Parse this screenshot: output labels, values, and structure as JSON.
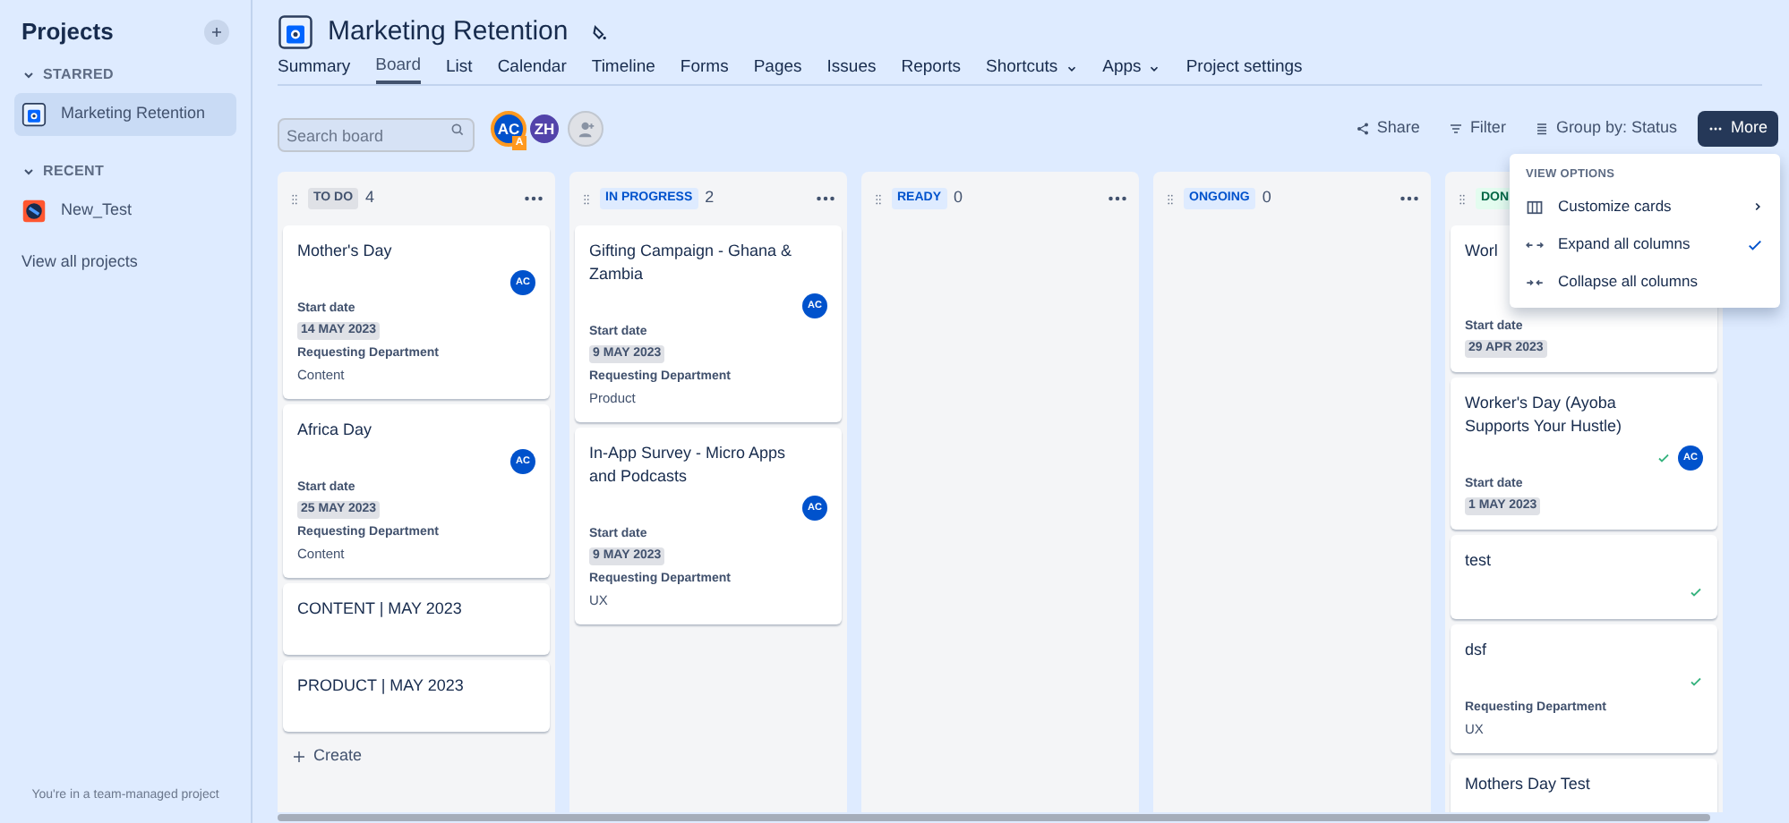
{
  "sidebar": {
    "title": "Projects",
    "sections": [
      {
        "heading": "STARRED",
        "expanded": true,
        "items": [
          {
            "label": "Marketing Retention",
            "selected": true,
            "kind": "board"
          }
        ]
      },
      {
        "heading": "RECENT",
        "expanded": true,
        "items": [
          {
            "label": "New_Test",
            "selected": false,
            "kind": "test"
          }
        ]
      }
    ],
    "view_all": "View all projects",
    "footer": "You're in a team-managed project"
  },
  "project": {
    "title": "Marketing Retention"
  },
  "tabs": [
    {
      "label": "Summary",
      "selected": false,
      "dropdown": false
    },
    {
      "label": "Board",
      "selected": true,
      "dropdown": false
    },
    {
      "label": "List",
      "selected": false,
      "dropdown": false
    },
    {
      "label": "Calendar",
      "selected": false,
      "dropdown": false
    },
    {
      "label": "Timeline",
      "selected": false,
      "dropdown": false
    },
    {
      "label": "Forms",
      "selected": false,
      "dropdown": false
    },
    {
      "label": "Pages",
      "selected": false,
      "dropdown": false
    },
    {
      "label": "Issues",
      "selected": false,
      "dropdown": false
    },
    {
      "label": "Reports",
      "selected": false,
      "dropdown": false
    },
    {
      "label": "Shortcuts",
      "selected": false,
      "dropdown": true
    },
    {
      "label": "Apps",
      "selected": false,
      "dropdown": true
    },
    {
      "label": "Project settings",
      "selected": false,
      "dropdown": false
    }
  ],
  "toolbar": {
    "search": {
      "placeholder": "Search board"
    },
    "avatars": [
      {
        "initials": "AC",
        "color": "#0052cc",
        "badge": "A"
      },
      {
        "initials": "ZH",
        "color": "#5243aa"
      }
    ],
    "actions": [
      {
        "label": "Share",
        "kind": "share"
      },
      {
        "label": "Filter",
        "kind": "filter"
      },
      {
        "label": "Group by: Status",
        "kind": "group"
      },
      {
        "label": "More",
        "kind": "more"
      }
    ]
  },
  "columns": [
    {
      "status": "TO DO",
      "kind": "todo",
      "count": "4",
      "cards": [
        {
          "title": "Mother's Day",
          "avatar": "AC",
          "done": false,
          "fields": [
            {
              "label": "Start date",
              "value": "14 MAY 2023",
              "kind": "date"
            },
            {
              "label": "Requesting Department",
              "value": "Content",
              "kind": "text"
            }
          ]
        },
        {
          "title": "Africa Day",
          "avatar": "AC",
          "done": false,
          "fields": [
            {
              "label": "Start date",
              "value": "25 MAY 2023",
              "kind": "date"
            },
            {
              "label": "Requesting Department",
              "value": "Content",
              "kind": "text"
            }
          ]
        },
        {
          "title": "CONTENT | MAY 2023",
          "done": false
        },
        {
          "title": "PRODUCT | MAY 2023",
          "done": false
        }
      ],
      "create": "Create"
    },
    {
      "status": "IN PROGRESS",
      "kind": "active",
      "count": "2",
      "cards": [
        {
          "title": "Gifting Campaign - Ghana & Zambia",
          "avatar": "AC",
          "done": false,
          "fields": [
            {
              "label": "Start date",
              "value": "9 MAY 2023",
              "kind": "date"
            },
            {
              "label": "Requesting Department",
              "value": "Product",
              "kind": "text"
            }
          ]
        },
        {
          "title": "In-App Survey - Micro Apps and Podcasts",
          "avatar": "AC",
          "done": false,
          "fields": [
            {
              "label": "Start date",
              "value": "9 MAY 2023",
              "kind": "date"
            },
            {
              "label": "Requesting Department",
              "value": "UX",
              "kind": "text"
            }
          ]
        }
      ]
    },
    {
      "status": "READY",
      "kind": "active",
      "count": "0"
    },
    {
      "status": "ONGOING",
      "kind": "active",
      "count": "0"
    },
    {
      "status": "DON",
      "kind": "done",
      "cards": [
        {
          "title": "Worl",
          "done": false,
          "fields": [
            {
              "label": "Start date",
              "value": "29 APR 2023",
              "kind": "date"
            }
          ]
        },
        {
          "title": "Worker's Day (Ayoba Supports Your Hustle)",
          "avatar": "AC",
          "done": true,
          "fields": [
            {
              "label": "Start date",
              "value": "1 MAY 2023",
              "kind": "date"
            }
          ]
        },
        {
          "title": "test",
          "done": true
        },
        {
          "title": "dsf",
          "done": true,
          "fields": [
            {
              "label": "Requesting Department",
              "value": "UX",
              "kind": "text"
            }
          ]
        },
        {
          "title": "Mothers Day Test",
          "done": false
        }
      ]
    }
  ],
  "menu": {
    "heading": "VIEW OPTIONS",
    "items": [
      {
        "label": "Customize cards",
        "kind": "customize",
        "submenu": true,
        "checked": false
      },
      {
        "label": "Expand all columns",
        "kind": "expand",
        "submenu": false,
        "checked": true
      },
      {
        "label": "Collapse all columns",
        "kind": "collapse",
        "submenu": false,
        "checked": false
      }
    ]
  }
}
